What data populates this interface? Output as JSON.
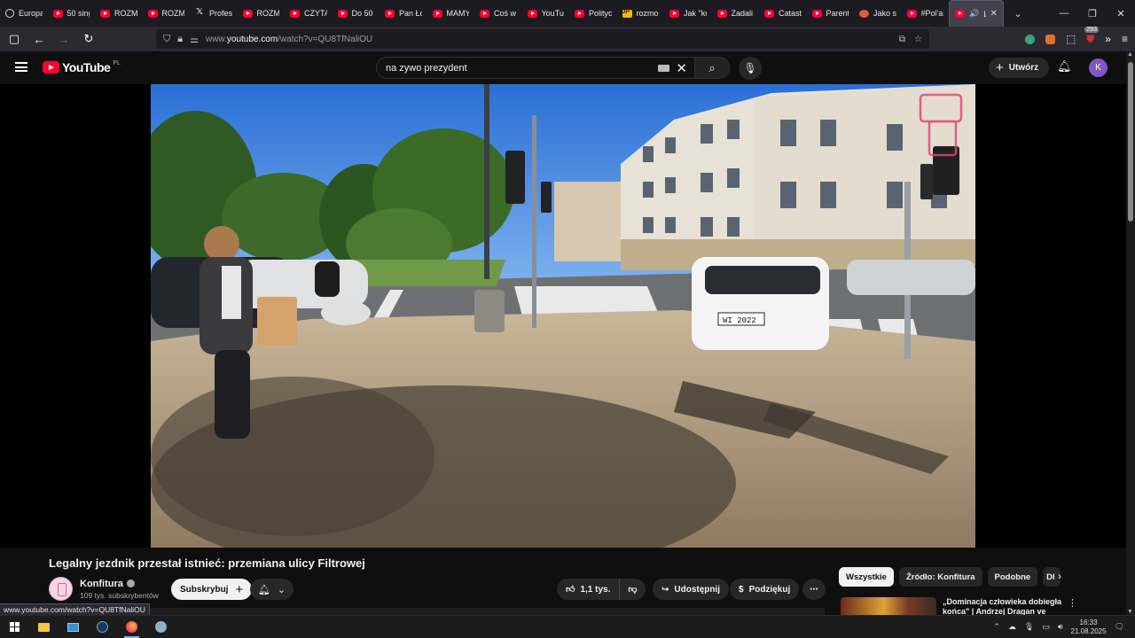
{
  "browser": {
    "tabs": [
      {
        "label": "Europa",
        "icon": "globe"
      },
      {
        "label": "50 sing",
        "icon": "youtube"
      },
      {
        "label": "ROZM",
        "icon": "youtube"
      },
      {
        "label": "ROZM",
        "icon": "youtube"
      },
      {
        "label": "Profes",
        "icon": "x"
      },
      {
        "label": "ROZM",
        "icon": "youtube"
      },
      {
        "label": "CZYTA",
        "icon": "youtube"
      },
      {
        "label": "Do 50",
        "icon": "youtube"
      },
      {
        "label": "Pan Ło",
        "icon": "youtube"
      },
      {
        "label": "MAMY",
        "icon": "youtube"
      },
      {
        "label": "Coś w",
        "icon": "youtube"
      },
      {
        "label": "YouTu",
        "icon": "youtube"
      },
      {
        "label": "Polityc",
        "icon": "youtube"
      },
      {
        "label": "rozmo",
        "icon": "jp"
      },
      {
        "label": "Jak \"ko",
        "icon": "youtube"
      },
      {
        "label": "Zadali",
        "icon": "youtube"
      },
      {
        "label": "Catastr",
        "icon": "youtube"
      },
      {
        "label": "Parent",
        "icon": "youtube"
      },
      {
        "label": "Jako s",
        "icon": "face"
      },
      {
        "label": "#Pol'ar",
        "icon": "youtube"
      }
    ],
    "active_tab": {
      "label": "Leg",
      "icon": "youtube"
    },
    "url_prefix": "www.",
    "url_main": "youtube.com",
    "url_rest": "/watch?v=QU8TfNaliOU",
    "extension_badge": "293",
    "status_url": "www.youtube.com/watch?v=QU8TfNaliOU"
  },
  "youtube": {
    "logo_text": "YouTube",
    "country_code": "PL",
    "search_query": "na zywo prezydent",
    "create_label": "Utwórz",
    "avatar_letter": "K"
  },
  "video": {
    "title": "Legalny jezdnik przestał istnieć: przemiana ulicy Filtrowej",
    "plate": "WI 2022"
  },
  "channel": {
    "name": "Konfitura",
    "subscribers": "109 tys. subskrybentów",
    "subscribe_label": "Subskrybuj"
  },
  "actions": {
    "likes": "1,1 tys.",
    "share_label": "Udostępnij",
    "thanks_label": "Podziękuj"
  },
  "chips": [
    "Wszystkie",
    "Źródło: Konfitura",
    "Podobne",
    "Dl"
  ],
  "recommendation": {
    "title": "„Dominacja człowieka dobiegła końca\" | Andrzej Dragan ve"
  },
  "taskbar": {
    "time": "16:33",
    "date": "21.08.2025"
  },
  "colors": {
    "yt_red": "#ff0033",
    "page_bg": "#0f0f0f",
    "browser_tabstrip": "#1c1b22",
    "browser_navbar": "#2b2a33",
    "avatar": "#7e57c2"
  }
}
